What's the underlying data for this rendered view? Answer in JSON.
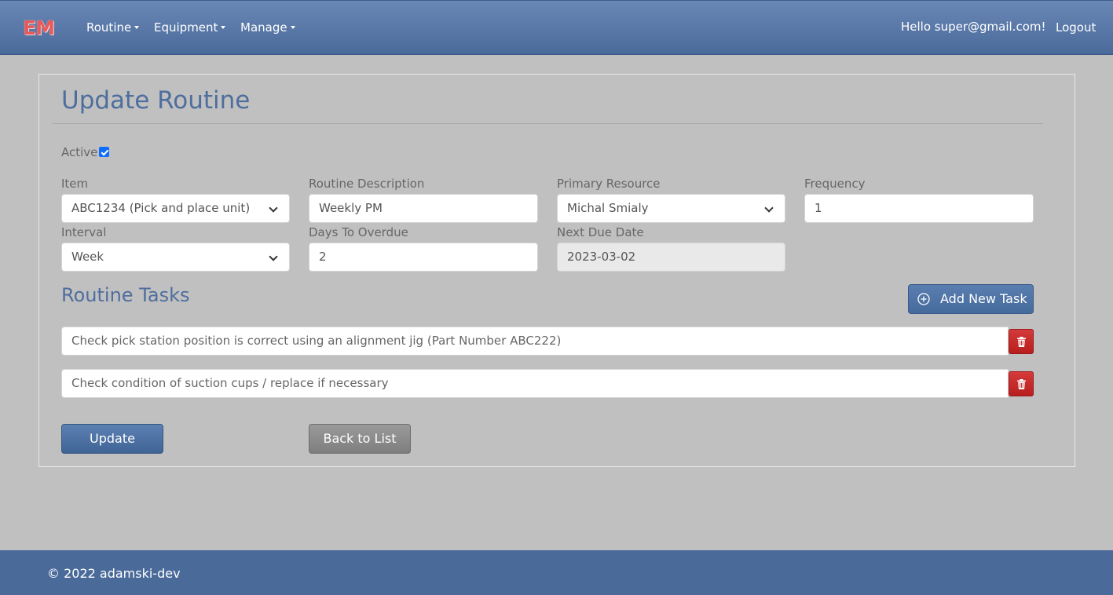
{
  "navbar": {
    "brand": "EM",
    "menus": [
      {
        "label": "Routine"
      },
      {
        "label": "Equipment"
      },
      {
        "label": "Manage"
      }
    ],
    "greeting": "Hello super@gmail.com!",
    "logout": "Logout"
  },
  "form": {
    "title": "Update Routine",
    "active": {
      "label": "Active",
      "checked": true
    },
    "item": {
      "label": "Item",
      "value": "ABC1234 (Pick and place unit)"
    },
    "description": {
      "label": "Routine Description",
      "value": "Weekly PM"
    },
    "primary_resource": {
      "label": "Primary Resource",
      "value": "Michal Smialy"
    },
    "frequency": {
      "label": "Frequency",
      "value": "1"
    },
    "interval": {
      "label": "Interval",
      "value": "Week"
    },
    "days_to_overdue": {
      "label": "Days To Overdue",
      "value": "2"
    },
    "next_due_date": {
      "label": "Next Due Date",
      "value": "2023-03-02"
    }
  },
  "tasks": {
    "title": "Routine Tasks",
    "add_label": "Add New Task",
    "items": [
      {
        "text": "Check pick station position is correct using an alignment jig (Part Number ABC222)"
      },
      {
        "text": "Check condition of suction cups / replace if necessary"
      }
    ]
  },
  "actions": {
    "update": "Update",
    "back": "Back to List"
  },
  "footer": {
    "text": "© 2022 adamski-dev"
  },
  "colors": {
    "primary": "#4a6a9a",
    "danger": "#c62828",
    "brand": "#e85a5a",
    "page_bg": "#c0c0c0"
  },
  "icons": {
    "add": "plus-circle-icon",
    "delete": "trash-icon",
    "dropdown": "chevron-down-icon"
  }
}
